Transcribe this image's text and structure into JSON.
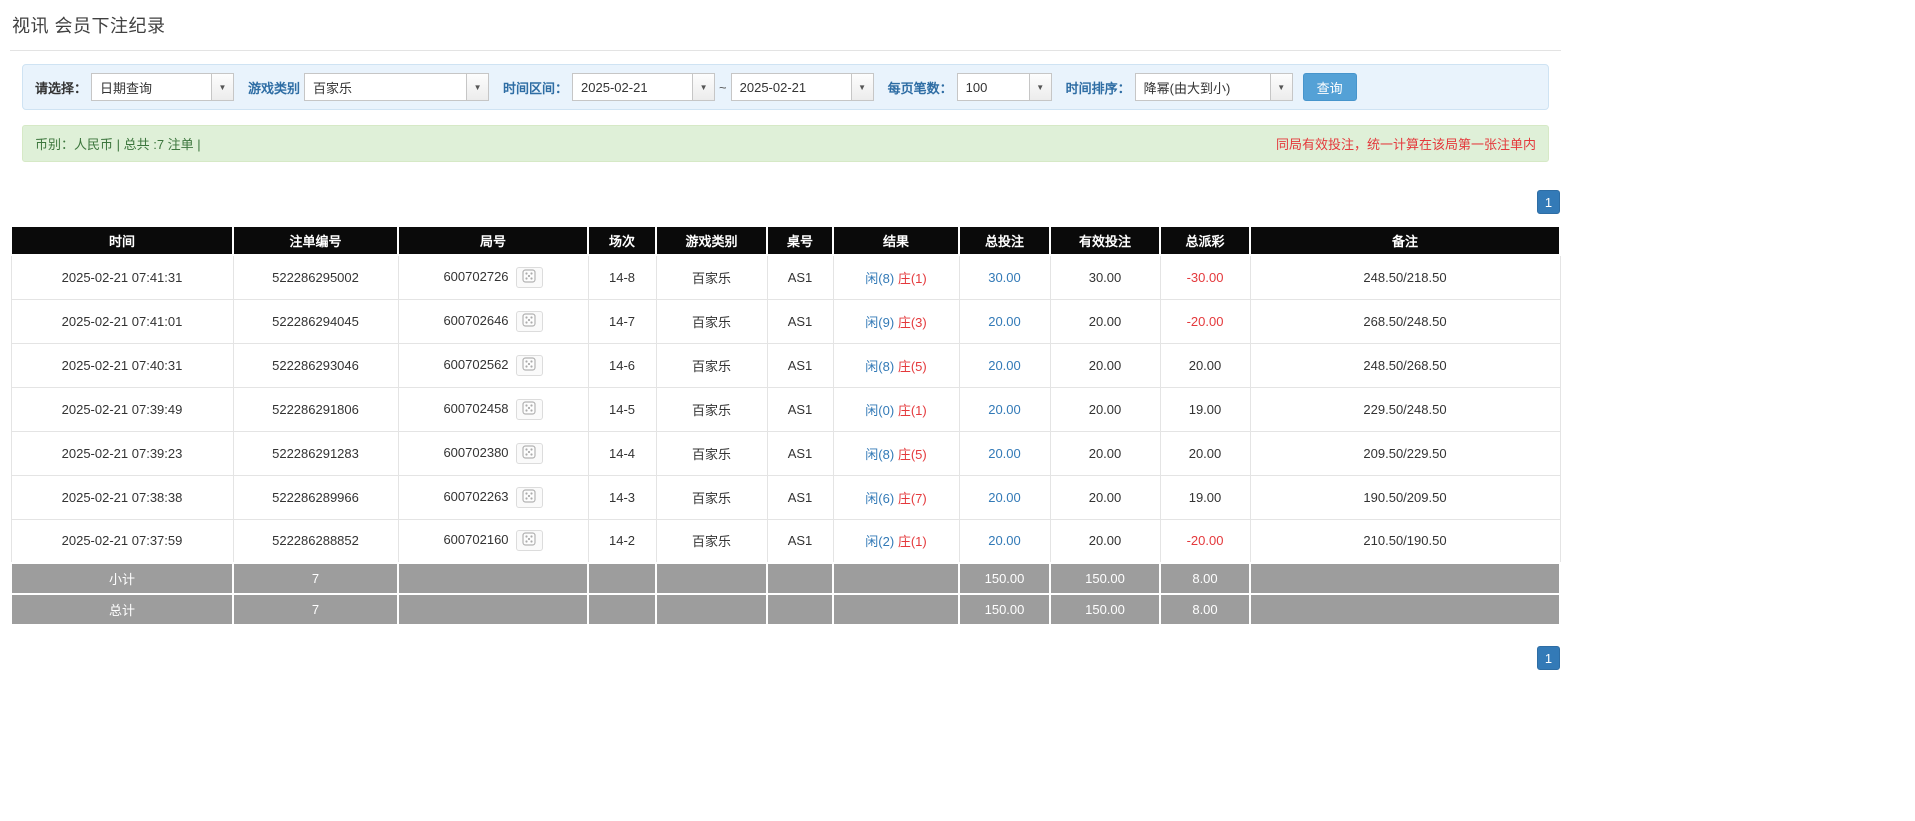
{
  "page": {
    "title": "视讯 会员下注纪录"
  },
  "filter": {
    "select_label": "请选择：",
    "select_value": "日期查询",
    "game_label": "游戏类别",
    "game_value": "百家乐",
    "range_label": "时间区间：",
    "date_from": "2025-02-21",
    "range_separator": "~",
    "date_to": "2025-02-21",
    "page_size_label": "每页笔数：",
    "page_size_value": "100",
    "sort_label": "时间排序：",
    "sort_value": "降幂(由大到小)",
    "query_button": "查询"
  },
  "summary": {
    "currency_info": "币别：人民币 | 总共 :7 注单 |",
    "notice": "同局有效投注，统一计算在该局第一张注单内"
  },
  "pagination": {
    "current_page": "1"
  },
  "table": {
    "headers": [
      "时间",
      "注单编号",
      "局号",
      "场次",
      "游戏类别",
      "桌号",
      "结果",
      "总投注",
      "有效投注",
      "总派彩",
      "备注"
    ],
    "rows": [
      {
        "time": "2025-02-21 07:41:31",
        "bet_id": "522286295002",
        "round_id": "600702726",
        "session": "14-8",
        "game": "百家乐",
        "table_no": "AS1",
        "result_player": "闲(8)",
        "result_banker": "庄(1)",
        "total_bet": "30.00",
        "valid_bet": "30.00",
        "payout": "-30.00",
        "note": "248.50/218.50"
      },
      {
        "time": "2025-02-21 07:41:01",
        "bet_id": "522286294045",
        "round_id": "600702646",
        "session": "14-7",
        "game": "百家乐",
        "table_no": "AS1",
        "result_player": "闲(9)",
        "result_banker": "庄(3)",
        "total_bet": "20.00",
        "valid_bet": "20.00",
        "payout": "-20.00",
        "note": "268.50/248.50"
      },
      {
        "time": "2025-02-21 07:40:31",
        "bet_id": "522286293046",
        "round_id": "600702562",
        "session": "14-6",
        "game": "百家乐",
        "table_no": "AS1",
        "result_player": "闲(8)",
        "result_banker": "庄(5)",
        "total_bet": "20.00",
        "valid_bet": "20.00",
        "payout": "20.00",
        "note": "248.50/268.50"
      },
      {
        "time": "2025-02-21 07:39:49",
        "bet_id": "522286291806",
        "round_id": "600702458",
        "session": "14-5",
        "game": "百家乐",
        "table_no": "AS1",
        "result_player": "闲(0)",
        "result_banker": "庄(1)",
        "total_bet": "20.00",
        "valid_bet": "20.00",
        "payout": "19.00",
        "note": "229.50/248.50"
      },
      {
        "time": "2025-02-21 07:39:23",
        "bet_id": "522286291283",
        "round_id": "600702380",
        "session": "14-4",
        "game": "百家乐",
        "table_no": "AS1",
        "result_player": "闲(8)",
        "result_banker": "庄(5)",
        "total_bet": "20.00",
        "valid_bet": "20.00",
        "payout": "20.00",
        "note": "209.50/229.50"
      },
      {
        "time": "2025-02-21 07:38:38",
        "bet_id": "522286289966",
        "round_id": "600702263",
        "session": "14-3",
        "game": "百家乐",
        "table_no": "AS1",
        "result_player": "闲(6)",
        "result_banker": "庄(7)",
        "total_bet": "20.00",
        "valid_bet": "20.00",
        "payout": "19.00",
        "note": "190.50/209.50"
      },
      {
        "time": "2025-02-21 07:37:59",
        "bet_id": "522286288852",
        "round_id": "600702160",
        "session": "14-2",
        "game": "百家乐",
        "table_no": "AS1",
        "result_player": "闲(2)",
        "result_banker": "庄(1)",
        "total_bet": "20.00",
        "valid_bet": "20.00",
        "payout": "-20.00",
        "note": "210.50/190.50"
      }
    ],
    "subtotal": {
      "label": "小计",
      "count": "7",
      "total_bet": "150.00",
      "valid_bet": "150.00",
      "payout": "8.00"
    },
    "total": {
      "label": "总计",
      "count": "7",
      "total_bet": "150.00",
      "valid_bet": "150.00",
      "payout": "8.00"
    }
  },
  "colors": {
    "accent_blue": "#337ab7",
    "negative_red": "#e4393c",
    "header_black": "#0a0a0a",
    "footer_gray": "#9d9d9d",
    "summary_green_bg": "#dff0d8",
    "filter_blue_bg": "#e9f3fc"
  }
}
